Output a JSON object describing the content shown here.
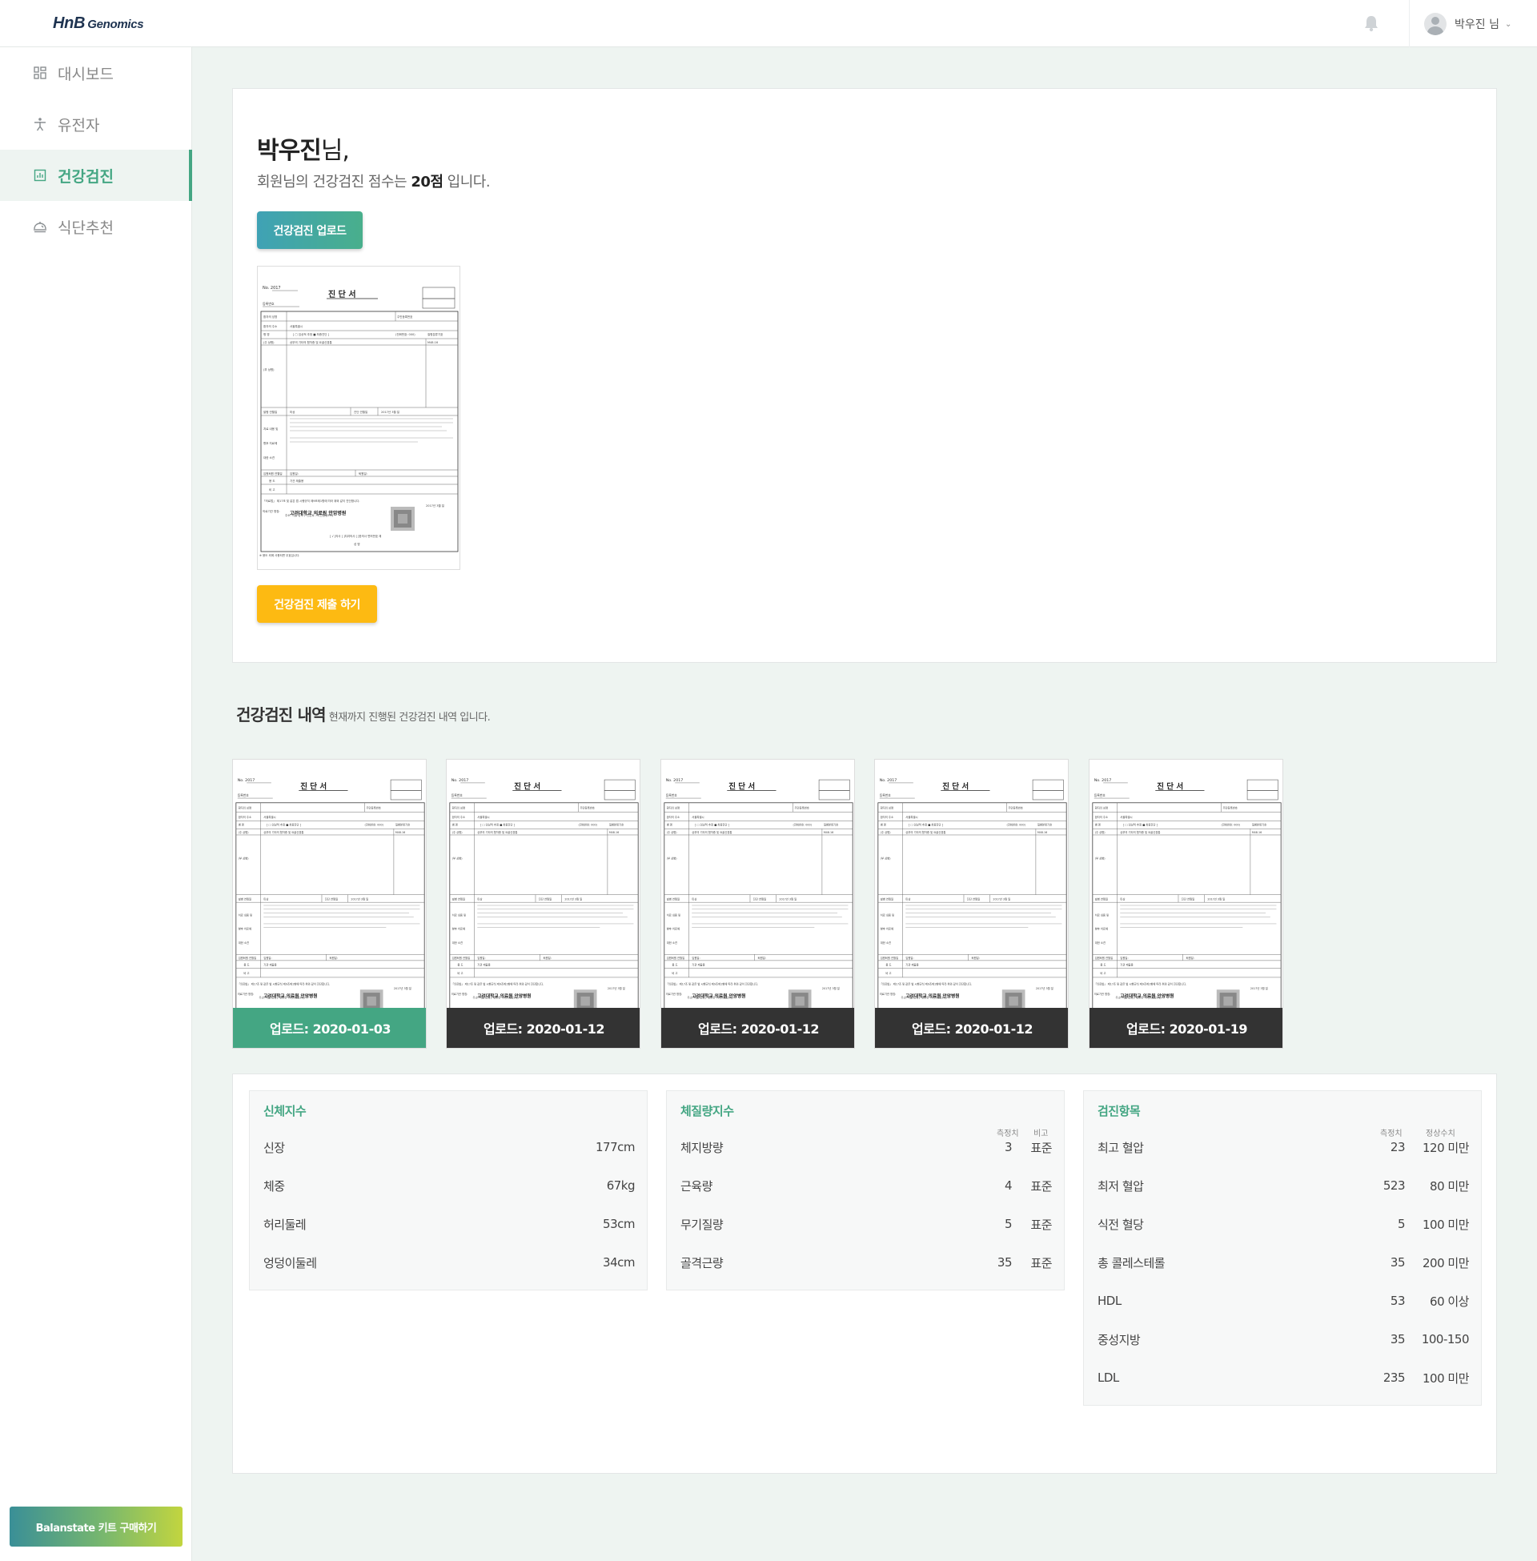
{
  "app": {
    "logo_hnb": "HnB",
    "logo_genomics": "Genomics",
    "user_name": "박우진 님"
  },
  "sidebar": {
    "items": [
      {
        "label": "대시보드",
        "icon": "dashboard-grid-icon",
        "active": false
      },
      {
        "label": "유전자",
        "icon": "person-gene-icon",
        "active": false
      },
      {
        "label": "건강검진",
        "icon": "chart-report-icon",
        "active": true
      },
      {
        "label": "식단추천",
        "icon": "meal-tray-icon",
        "active": false
      }
    ],
    "kit_button": "Balanstate 키트 구매하기"
  },
  "summary": {
    "name": "박우진",
    "name_suffix": "님,",
    "score_prefix": "회원님의 건강검진 점수는 ",
    "score_value": "20점",
    "score_suffix": " 입니다.",
    "upload_button": "건강검진 업로드",
    "submit_button": "건강검진 제출 하기"
  },
  "history": {
    "title": "건강검진 내역",
    "subtitle": "현재까지 진행된 건강검진 내역 입니다.",
    "items": [
      {
        "caption": "업로드: 2020-01-03",
        "active": true
      },
      {
        "caption": "업로드: 2020-01-12",
        "active": false
      },
      {
        "caption": "업로드: 2020-01-12",
        "active": false
      },
      {
        "caption": "업로드: 2020-01-12",
        "active": false
      },
      {
        "caption": "업로드: 2020-01-19",
        "active": false
      }
    ]
  },
  "body_index": {
    "title": "신체지수",
    "rows": [
      {
        "label": "신장",
        "value": "177cm"
      },
      {
        "label": "체중",
        "value": "67kg"
      },
      {
        "label": "허리둘레",
        "value": "53cm"
      },
      {
        "label": "엉덩이둘레",
        "value": "34cm"
      }
    ]
  },
  "body_composition": {
    "title": "체질량지수",
    "col_measure": "측정치",
    "col_compare": "비고",
    "rows": [
      {
        "label": "체지방량",
        "value": "3",
        "compare": "표준"
      },
      {
        "label": "근육량",
        "value": "4",
        "compare": "표준"
      },
      {
        "label": "무기질량",
        "value": "5",
        "compare": "표준"
      },
      {
        "label": "골격근량",
        "value": "35",
        "compare": "표준"
      }
    ]
  },
  "exam_items": {
    "title": "검진항목",
    "col_measure": "측정치",
    "col_normal": "정상수치",
    "rows": [
      {
        "label": "최고 혈압",
        "value": "23",
        "normal": "120 미만"
      },
      {
        "label": "최저 혈압",
        "value": "523",
        "normal": "80 미만"
      },
      {
        "label": "식전 혈당",
        "value": "5",
        "normal": "100 미만"
      },
      {
        "label": "총 콜레스테롤",
        "value": "35",
        "normal": "200 미만"
      },
      {
        "label": "HDL",
        "value": "53",
        "normal": "60 이상"
      },
      {
        "label": "중성지방",
        "value": "35",
        "normal": "100-150"
      },
      {
        "label": "LDL",
        "value": "235",
        "normal": "100 미만"
      }
    ]
  },
  "document": {
    "title": "진 단 서",
    "hospital": "고려대학교 의료원 안암병원"
  }
}
